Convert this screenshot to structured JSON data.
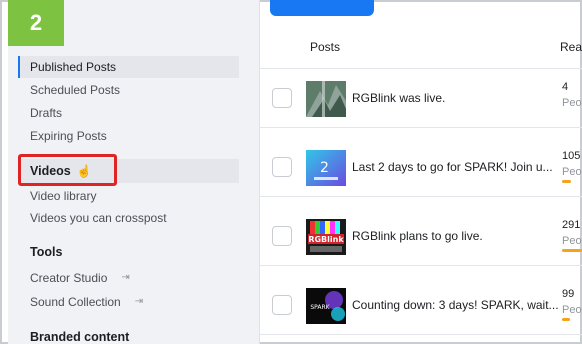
{
  "step_badge": "2",
  "sidebar": {
    "items": [
      {
        "label": "Published Posts"
      },
      {
        "label": "Scheduled Posts"
      },
      {
        "label": "Drafts"
      },
      {
        "label": "Expiring Posts"
      },
      {
        "label": "Videos"
      },
      {
        "label": "Video library"
      },
      {
        "label": "Videos you can crosspost"
      },
      {
        "label": "Tools"
      },
      {
        "label": "Creator Studio"
      },
      {
        "label": "Sound Collection"
      },
      {
        "label": "Branded content"
      }
    ]
  },
  "table": {
    "headers": {
      "posts": "Posts",
      "reach": "Rea"
    },
    "rows": [
      {
        "title": "RGBlink was live.",
        "reach": "4",
        "reach_sub": "Peo",
        "reach_bar_fraction": 0
      },
      {
        "title": "Last 2 days to go for SPARK! Join u...",
        "reach": "105",
        "reach_sub": "Peo",
        "reach_bar_fraction": 0.4
      },
      {
        "title": "RGBlink plans to go live.",
        "reach": "291",
        "reach_sub": "Peo",
        "reach_bar_fraction": 0.9
      },
      {
        "title": "Counting down: 3 days! SPARK, wait...",
        "reach": "99",
        "reach_sub": "Peo",
        "reach_bar_fraction": 0.35
      }
    ]
  },
  "thumbs": {
    "row3_logo": "RGBlink",
    "row4_logo": "SPARK"
  },
  "colors": {
    "accent": "#1877f2",
    "highlight_box": "#e02424",
    "step_badge": "#7ec242",
    "reach_bar_orange": "#f7a21b",
    "reach_bar_blue": "#1877f2"
  }
}
